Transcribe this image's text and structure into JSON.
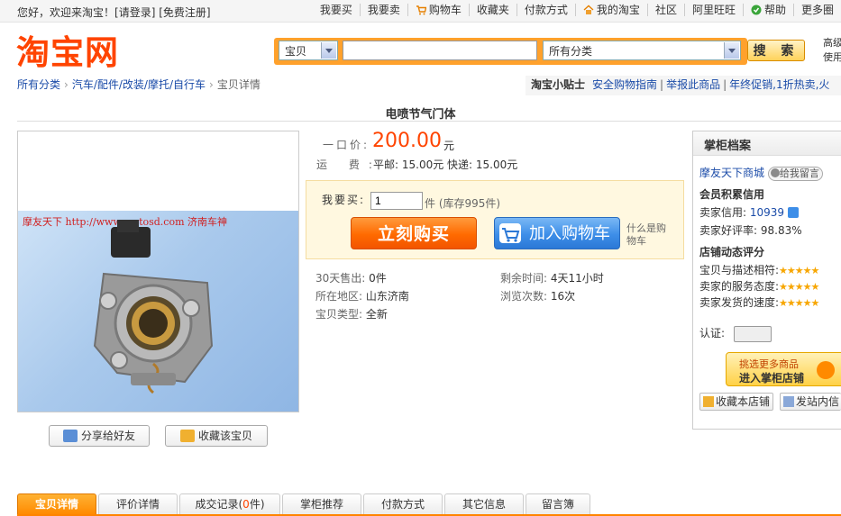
{
  "topbar": {
    "welcome_prefix": "您好，欢迎来淘宝！",
    "login_link": "[请登录]",
    "register_link": "[免费注册]",
    "nav": [
      {
        "label": "我要买",
        "icon": ""
      },
      {
        "label": "我要卖",
        "icon": ""
      },
      {
        "label": "购物车",
        "icon": "cart-icon"
      },
      {
        "label": "收藏夹",
        "icon": ""
      },
      {
        "label": "付款方式",
        "icon": ""
      },
      {
        "label": "我的淘宝",
        "icon": "home-icon"
      },
      {
        "label": "社区",
        "icon": ""
      },
      {
        "label": "阿里旺旺",
        "icon": ""
      },
      {
        "label": "帮助",
        "icon": "help-icon"
      },
      {
        "label": "更多圈",
        "icon": ""
      }
    ]
  },
  "header": {
    "logo_text": "淘宝网",
    "search_type": "宝贝",
    "search_query": "",
    "category_select": "所有分类",
    "search_button": "搜 索",
    "advanced_line1": "高级",
    "advanced_line2": "使用"
  },
  "breadcrumb": {
    "items": [
      "所有分类",
      "汽车/配件/改装/摩托/自行车",
      "宝贝详情"
    ],
    "separator": "›"
  },
  "tips": {
    "title": "淘宝小贴士",
    "links": [
      "安全购物指南",
      "举报此商品",
      "年终促销,1折热卖,火"
    ]
  },
  "product": {
    "title": "电喷节气门体",
    "watermark": "摩友天下 http://www.motosd.com 济南车神",
    "price_label": "一口价:",
    "price": "200.00",
    "price_unit": "元",
    "shipping_label": "运  费:",
    "shipping": "平邮: 15.00元 快递: 15.00元",
    "want_buy_label": "我要买:",
    "quantity": "1",
    "stock_text": "件 (库存995件)",
    "buy_now": "立刻购买",
    "add_to_cart": "加入购物车",
    "what_cart": "什么是购物车",
    "stats": {
      "sold_label": "30天售出:",
      "sold": "0件",
      "remaining_label": "剩余时间:",
      "remaining": "4天11小时",
      "location_label": "所在地区:",
      "location": "山东济南",
      "views_label": "浏览次数:",
      "views": "16次",
      "type_label": "宝贝类型:",
      "type": "全新"
    },
    "share_button": "分享给好友",
    "favorite_button": "收藏该宝贝"
  },
  "tabs": [
    {
      "label": "宝贝详情",
      "active": true
    },
    {
      "label": "评价详情",
      "active": false
    },
    {
      "label": "成交记录",
      "count": "0",
      "suffix": "件",
      "active": false
    },
    {
      "label": "掌柜推荐",
      "active": false
    },
    {
      "label": "付款方式",
      "active": false
    },
    {
      "label": "其它信息",
      "active": false
    },
    {
      "label": "留言簿",
      "active": false
    }
  ],
  "seller": {
    "header": "掌柜档案",
    "shop_name": "摩友天下商城",
    "message_button": "给我留言",
    "credit_title": "会员积累信用",
    "credit_label": "卖家信用:",
    "credit_value": "10939",
    "rate_label": "卖家好评率:",
    "rate_value": "98.83%",
    "dynamic_title": "店铺动态评分",
    "ratings": [
      {
        "label": "宝贝与描述相符:",
        "stars": "★★★★★"
      },
      {
        "label": "卖家的服务态度:",
        "stars": "★★★★★"
      },
      {
        "label": "卖家发货的速度:",
        "stars": "★★★★★"
      }
    ],
    "cert_label": "认证:",
    "more_items": "挑选更多商品",
    "enter_shop": "进入掌柜店铺",
    "fav_shop": "收藏本店铺",
    "send_msg": "发站内信"
  }
}
